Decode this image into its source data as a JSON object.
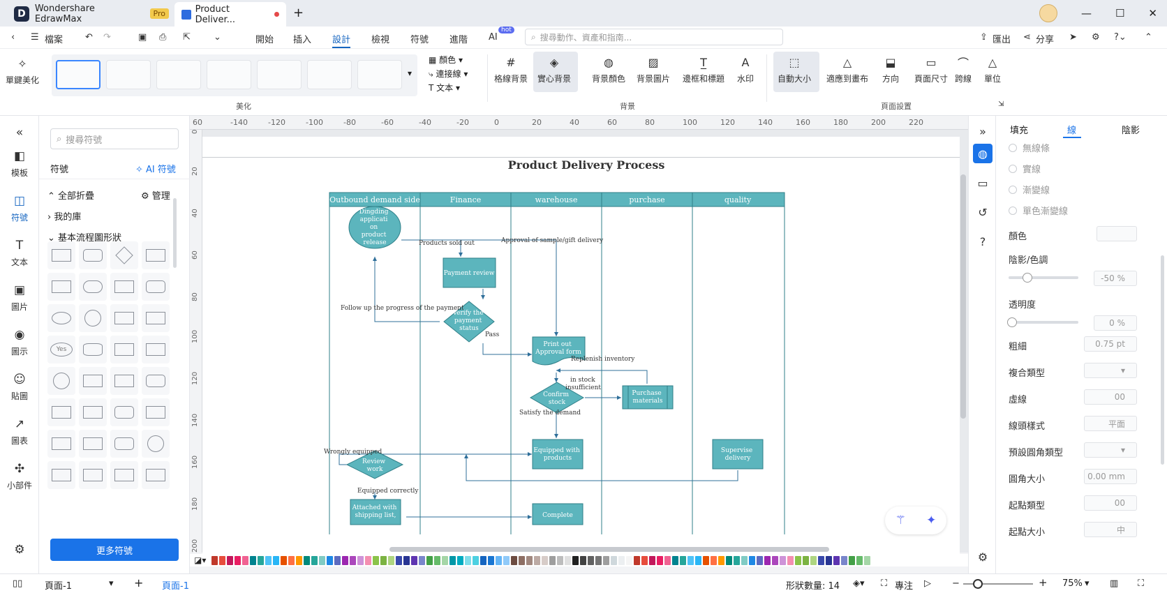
{
  "app": {
    "name": "Wondershare EdrawMax",
    "badge": "Pro",
    "doc_tab": "Product Deliver..."
  },
  "menu": {
    "file": "檔案",
    "items": [
      "開始",
      "插入",
      "設計",
      "檢視",
      "符號",
      "進階",
      "AI"
    ],
    "hot": "hot",
    "search_placeholder": "搜尋動作、資產和指南...",
    "export": "匯出",
    "share": "分享"
  },
  "ribbon": {
    "beautify": "單鍵美化",
    "group_beautify": "美化",
    "color": "顏色",
    "connector": "連接線",
    "text": "文本",
    "grid_bg": "格線背景",
    "solid_bg": "實心背景",
    "bg_color": "背景顏色",
    "bg_image": "背景圖片",
    "border_title": "邊框和標題",
    "watermark": "水印",
    "group_bg": "背景",
    "auto_size": "自動大小",
    "fit_canvas": "適應到畫布",
    "orientation": "方向",
    "page_size": "頁面尺寸",
    "jump": "跨線",
    "unit": "單位",
    "group_page": "頁面設置"
  },
  "leftnav": [
    "模板",
    "符號",
    "文本",
    "圖片",
    "圖示",
    "貼圖",
    "圖表",
    "小部件"
  ],
  "symbols": {
    "search_placeholder": "搜尋符號",
    "title": "符號",
    "ai": "AI 符號",
    "collapse_all": "全部折疊",
    "manage": "管理",
    "my_library": "我的庫",
    "basic_flow": "基本流程圖形狀",
    "more": "更多符號",
    "yes_label": "Yes"
  },
  "ruler": {
    "top": [
      "60",
      "-140",
      "-120",
      "-100",
      "-80",
      "-60",
      "-40",
      "-20",
      "0",
      "20",
      "40",
      "60",
      "80",
      "100",
      "120",
      "140",
      "160",
      "180",
      "200",
      "220"
    ],
    "left": [
      "0",
      "20",
      "40",
      "60",
      "80",
      "100",
      "120",
      "140",
      "160",
      "180",
      "200"
    ]
  },
  "diagram": {
    "title": "Product Delivery Process",
    "lanes": [
      "Outbound demand side",
      "Finance",
      "warehouse",
      "purchase",
      "quality"
    ],
    "nodes": {
      "dingding": [
        "Dingding",
        "applicati",
        "on",
        "product",
        "release"
      ],
      "payment_review": "Payment review",
      "verify": [
        "Verify the",
        "payment",
        "status"
      ],
      "print": [
        "Print out",
        "Approval form"
      ],
      "confirm": [
        "Confirm",
        "stock"
      ],
      "purchase": [
        "Purchase",
        "materials"
      ],
      "equipped": [
        "Equipped with",
        "products"
      ],
      "supervise": [
        "Supervise",
        "delivery"
      ],
      "review": [
        "Review",
        "work"
      ],
      "attached": [
        "Attached with",
        "shipping list,"
      ],
      "complete": "Complete"
    },
    "labels": {
      "sold_out": "Products sold out",
      "approval": "Approval of sample/gift delivery",
      "follow": "Follow up the progress of the payment",
      "pass": "Pass",
      "replenish": "Replenish inventory",
      "in_stock": "in stock",
      "insufficient": "insufficient",
      "satisfy": "Satisfy the demand",
      "wrongly": "Wrongly equipped",
      "correctly": "Equipped correctly"
    }
  },
  "props": {
    "tabs": [
      "填充",
      "線",
      "陰影"
    ],
    "line_opts": [
      "無線條",
      "實線",
      "漸變線",
      "單色漸變線"
    ],
    "color": "顏色",
    "shade": "陰影/色調",
    "shade_val": "-50 %",
    "transparency": "透明度",
    "transparency_val": "0 %",
    "width": "粗細",
    "width_val": "0.75 pt",
    "compound": "複合類型",
    "dash": "虛線",
    "dash_val": "00",
    "arrow": "線頭樣式",
    "arrow_val": "平面",
    "corner_type": "預設圓角類型",
    "corner_size": "圓角大小",
    "corner_val": "0.00 mm",
    "start_type": "起點類型",
    "start_val": "00",
    "start_size": "起點大小",
    "start_size_val": "中"
  },
  "status": {
    "page_sel": "頁面-1",
    "page_tab": "頁面-1",
    "shape_count": "形狀數量: 14",
    "focus": "專注",
    "zoom": "75%"
  },
  "colors": {
    "accent": "#1a73e8",
    "node": "#5cb5bd",
    "node_stroke": "#2f7f88",
    "lane_header": "#5cb5bd"
  }
}
